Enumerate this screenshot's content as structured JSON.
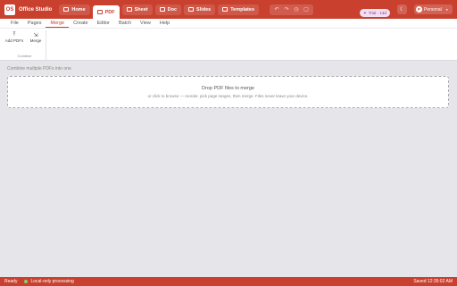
{
  "app": {
    "logo_text": "OS",
    "name": "Office Studio"
  },
  "tabs": [
    {
      "label": "Home",
      "icon": "home-icon"
    },
    {
      "label": "PDF",
      "icon": "pdf-icon"
    },
    {
      "label": "Sheet",
      "icon": "sheet-icon"
    },
    {
      "label": "Doc",
      "icon": "doc-icon"
    },
    {
      "label": "Slides",
      "icon": "slides-icon"
    },
    {
      "label": "Templates",
      "icon": "templates-icon"
    }
  ],
  "active_tab": "PDF",
  "quick_actions": [
    "undo-icon",
    "redo-icon",
    "history-icon",
    "save-icon"
  ],
  "trial": {
    "label": "Trial · 14d"
  },
  "profile": {
    "initial": "P",
    "label": "Personal"
  },
  "menu": [
    "File",
    "Pages",
    "Merge",
    "Create",
    "Editor",
    "Batch",
    "View",
    "Help"
  ],
  "active_menu": "Merge",
  "ribbon": {
    "group_label": "Combine",
    "buttons": [
      {
        "label": "Add PDFs",
        "icon": "add-file-icon"
      },
      {
        "label": "Merge",
        "icon": "merge-icon"
      }
    ]
  },
  "main": {
    "hint": "Combine multiple PDFs into one.",
    "drop_title": "Drop PDF files to merge",
    "drop_subtitle": "or click to browse — reorder, pick page ranges, then merge. Files never leave your device."
  },
  "status": {
    "ready": "Ready",
    "local": "Local-only processing",
    "saved": "Saved 12:35:02 AM"
  },
  "colors": {
    "accent": "#c9402f",
    "background": "#e6e6ea",
    "trial_bg": "#f1dff2"
  }
}
